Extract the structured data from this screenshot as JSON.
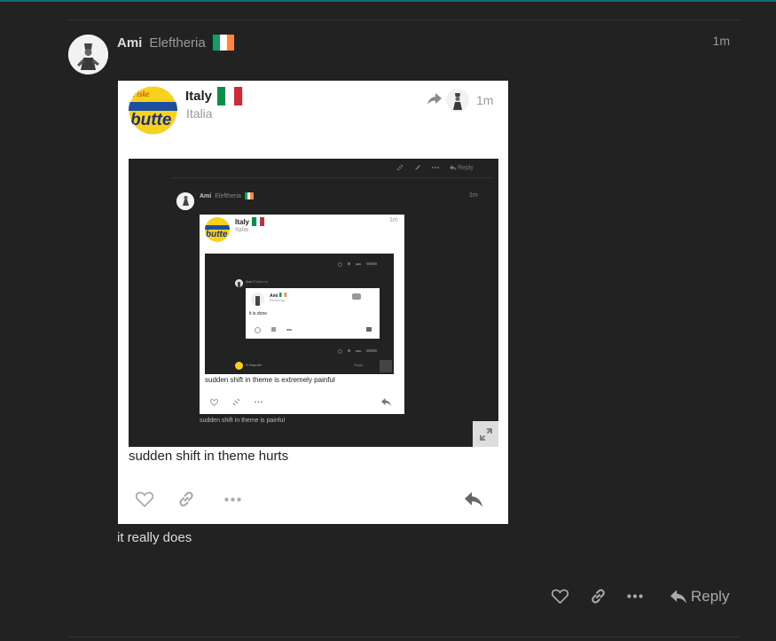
{
  "post": {
    "author": "Ami",
    "user_title": "Eleftheria",
    "time": "1m",
    "body": "it really does",
    "reply_label": "Reply"
  },
  "quote": {
    "author": "Italy",
    "user_title": "Italia",
    "time": "1m",
    "body": "sudden shift in theme hurts"
  },
  "screenshot": {
    "reply_label": "Reply",
    "inner_author": "Ami",
    "inner_title": "Eleftheria",
    "inner_time": "1m",
    "quote_author": "Italy",
    "quote_title": "Italia",
    "quote_time": "1m",
    "deep_author": "Ami",
    "deep_title": "Eleftheria",
    "deep_body": "it is done",
    "deep_quote_author": "Ami",
    "deep_quote_title": "Eleftheria",
    "quote_body": "sudden shift in theme is extremely painful",
    "caption": "sudden shift in theme is painful",
    "bottom_author": "S.Gepulet",
    "bottom_reply": "Reply"
  },
  "logo": {
    "text": "butte",
    "script": "Fiske"
  },
  "colors": {
    "background": "#222222",
    "accent": "#0e6c75",
    "flag_ireland": [
      "#169b62",
      "#ffffff",
      "#ff883e"
    ],
    "flag_italy": [
      "#009246",
      "#ffffff",
      "#ce2b37"
    ]
  },
  "icons": [
    "heart-icon",
    "link-icon",
    "more-icon",
    "reply-icon",
    "share-icon",
    "expand-icon",
    "pencil-icon"
  ]
}
